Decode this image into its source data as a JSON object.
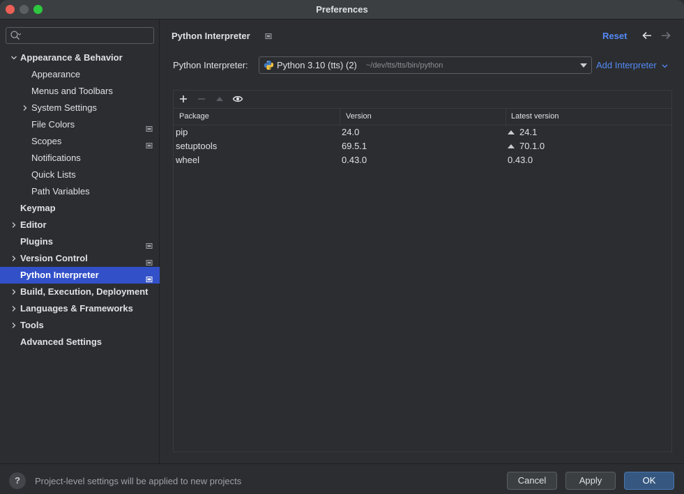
{
  "window": {
    "title": "Preferences"
  },
  "search": {
    "placeholder": ""
  },
  "sidebar": {
    "items": [
      {
        "label": "Appearance & Behavior",
        "level": "top",
        "expand": "open",
        "badge": false
      },
      {
        "label": "Appearance",
        "level": "sub",
        "expand": "none",
        "badge": false
      },
      {
        "label": "Menus and Toolbars",
        "level": "sub",
        "expand": "none",
        "badge": false
      },
      {
        "label": "System Settings",
        "level": "sub",
        "expand": "closed",
        "badge": false
      },
      {
        "label": "File Colors",
        "level": "sub",
        "expand": "none",
        "badge": true
      },
      {
        "label": "Scopes",
        "level": "sub",
        "expand": "none",
        "badge": true
      },
      {
        "label": "Notifications",
        "level": "sub",
        "expand": "none",
        "badge": false
      },
      {
        "label": "Quick Lists",
        "level": "sub",
        "expand": "none",
        "badge": false
      },
      {
        "label": "Path Variables",
        "level": "sub",
        "expand": "none",
        "badge": false
      },
      {
        "label": "Keymap",
        "level": "top",
        "expand": "none",
        "badge": false
      },
      {
        "label": "Editor",
        "level": "top",
        "expand": "closed",
        "badge": false
      },
      {
        "label": "Plugins",
        "level": "top",
        "expand": "none",
        "badge": true
      },
      {
        "label": "Version Control",
        "level": "top",
        "expand": "closed",
        "badge": true
      },
      {
        "label": "Python Interpreter",
        "level": "top",
        "expand": "none",
        "badge": true,
        "selected": true
      },
      {
        "label": "Build, Execution, Deployment",
        "level": "top",
        "expand": "closed",
        "badge": false
      },
      {
        "label": "Languages & Frameworks",
        "level": "top",
        "expand": "closed",
        "badge": false
      },
      {
        "label": "Tools",
        "level": "top",
        "expand": "closed",
        "badge": false
      },
      {
        "label": "Advanced Settings",
        "level": "top",
        "expand": "none",
        "badge": false
      }
    ]
  },
  "header": {
    "breadcrumb": "Python Interpreter",
    "reset_label": "Reset"
  },
  "interpreter": {
    "label": "Python Interpreter:",
    "name": "Python 3.10 (tts) (2)",
    "path": "~/dev/tts/tts/bin/python",
    "add_label": "Add Interpreter"
  },
  "packages": {
    "columns": [
      "Package",
      "Version",
      "Latest version"
    ],
    "rows": [
      {
        "name": "pip",
        "version": "24.0",
        "latest": "24.1",
        "upgrade": true
      },
      {
        "name": "setuptools",
        "version": "69.5.1",
        "latest": "70.1.0",
        "upgrade": true
      },
      {
        "name": "wheel",
        "version": "0.43.0",
        "latest": "0.43.0",
        "upgrade": false
      }
    ]
  },
  "footer": {
    "help_label": "?",
    "note": "Project-level settings will be applied to new projects",
    "cancel_label": "Cancel",
    "apply_label": "Apply",
    "ok_label": "OK"
  },
  "colors": {
    "accent": "#548af7",
    "selection": "#3250c8",
    "ok_button": "#365880"
  }
}
